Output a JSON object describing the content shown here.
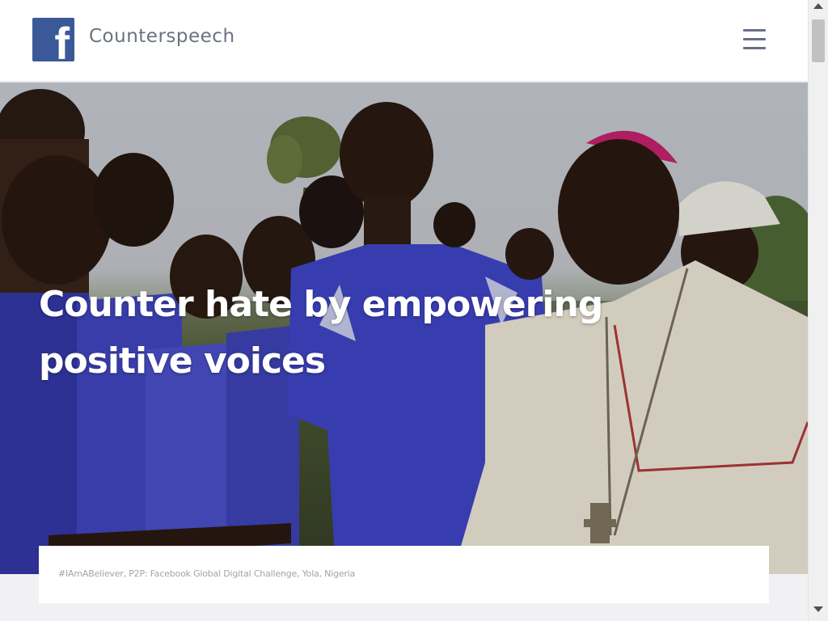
{
  "header": {
    "logo_icon": "facebook-logo-icon",
    "logo_glyph": "f",
    "brand_name": "Counterspeech",
    "menu_icon": "hamburger-menu-icon",
    "brand_color": "#3b5998"
  },
  "hero": {
    "title": "Counter hate by empowering positive voices",
    "image_description": "photo of people in blue jerseys shaking hands with a bishop"
  },
  "caption": {
    "text": "#IAmABeliever, P2P: Facebook Global Digital Challenge, Yola, Nigeria"
  },
  "scrollbar": {
    "up_icon": "scroll-up-arrow-icon",
    "down_icon": "scroll-down-arrow-icon"
  }
}
